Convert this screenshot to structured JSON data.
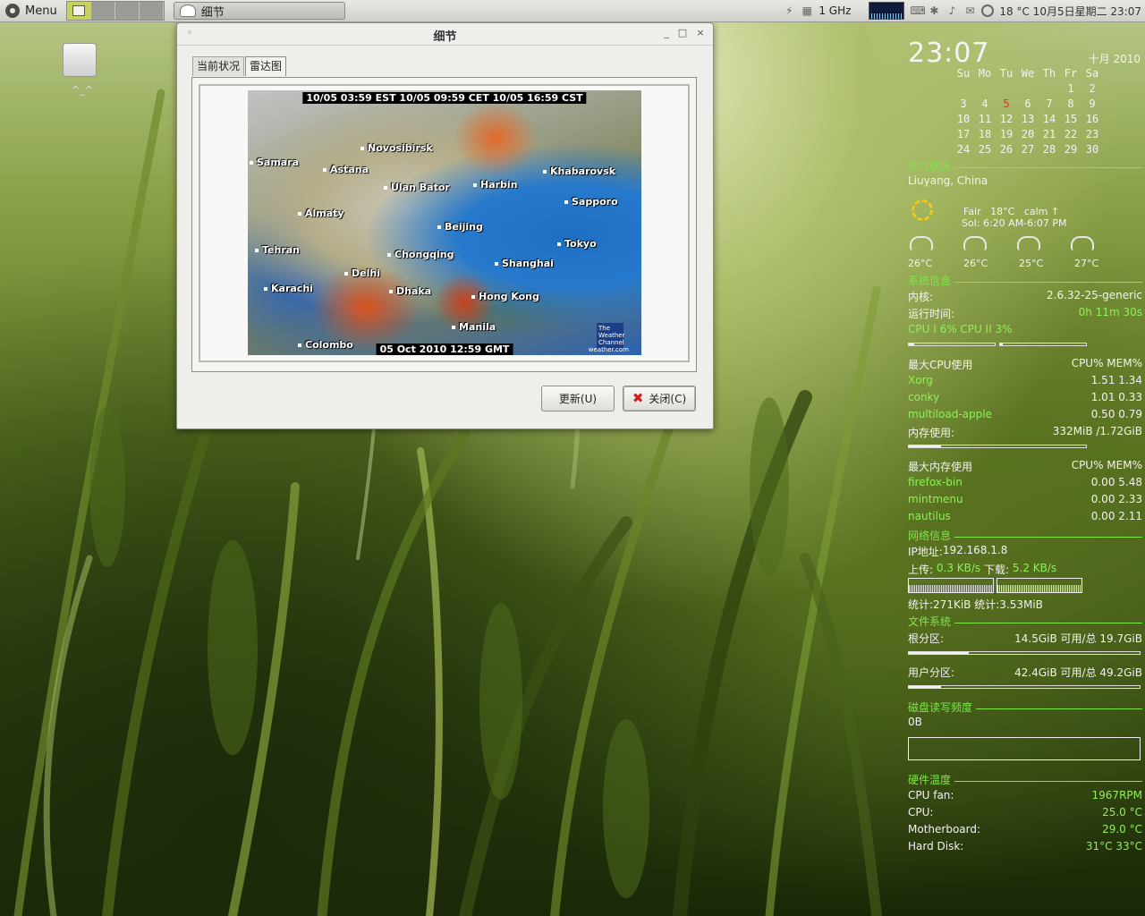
{
  "panel": {
    "menu_label": "Menu",
    "task_label": "细节",
    "cpu_freq": "1 GHz",
    "tray_text": "18 °C  10月5日星期二 23:07"
  },
  "desktop": {
    "drive_caption": "^_^"
  },
  "window": {
    "title": "细节",
    "tabs": [
      "当前状况",
      "雷达图"
    ],
    "active_tab": 1,
    "radar_top": "10/05 03:59 EST  10/05 09:59 CET  10/05 16:59 CST",
    "radar_bottom": "05 Oct 2010 12:59 GMT",
    "cities": [
      "Novosibirsk",
      "Samara",
      "Astana",
      "Khabarovsk",
      "Ulan Bator",
      "Harbin",
      "Sapporo",
      "Almaty",
      "Beijing",
      "Tokyo",
      "Tehran",
      "Chongqing",
      "Shanghai",
      "Delhi",
      "Karachi",
      "Dhaka",
      "Hong Kong",
      "Manila",
      "Colombo"
    ],
    "logo_text": "The Weather Channel",
    "logo_url": "weather.com",
    "refresh_label": "更新(U)",
    "close_label": "关闭(C)"
  },
  "conky": {
    "time": "23:07",
    "month_year": "十月 2010",
    "cal_header": [
      "Su",
      "Mo",
      "Tu",
      "We",
      "Th",
      "Fr",
      "Sa"
    ],
    "cal_rows": [
      [
        "",
        "",
        "",
        "",
        "",
        "1",
        "2"
      ],
      [
        "3",
        "4",
        "5",
        "6",
        "7",
        "8",
        "9"
      ],
      [
        "10",
        "11",
        "12",
        "13",
        "14",
        "15",
        "16"
      ],
      [
        "17",
        "18",
        "19",
        "20",
        "21",
        "22",
        "23"
      ],
      [
        "24",
        "25",
        "26",
        "27",
        "28",
        "29",
        "30"
      ]
    ],
    "today": "5",
    "weather_title": "天气状况",
    "location": "Liuyang, China",
    "cond": "Fair",
    "temp_now": "18°C",
    "wind": "calm",
    "sun": "Sol: 6:20 AM-6:07 PM",
    "forecast_temps": [
      "26°C",
      "26°C",
      "25°C",
      "27°C"
    ],
    "sys_title": "系统信息",
    "kernel_label": "内核:",
    "kernel": "2.6.32-25-generic",
    "uptime_label": "运行时间:",
    "uptime": "0h 11m 30s",
    "cpu_line": "CPU I 6% CPU II 3%",
    "cpu1_pct": 6,
    "cpu2_pct": 3,
    "topcpu_title": "最大CPU使用",
    "col_header": "CPU% MEM%",
    "topcpu": [
      {
        "name": "Xorg",
        "vals": "1.51  1.34"
      },
      {
        "name": "conky",
        "vals": "1.01  0.33"
      },
      {
        "name": "multiload-apple",
        "vals": "0.50  0.79"
      }
    ],
    "mem_label": "内存使用:",
    "mem_value": "332MiB /1.72GiB",
    "mem_pct": 18,
    "topmem_title": "最大内存使用",
    "topmem": [
      {
        "name": "firefox-bin",
        "vals": "0.00  5.48"
      },
      {
        "name": "mintmenu",
        "vals": "0.00  2.33"
      },
      {
        "name": "nautilus",
        "vals": "0.00  2.11"
      }
    ],
    "net_title": "网络信息",
    "ip_label": "IP地址:",
    "ip": "192.168.1.8",
    "up_label": "上传:",
    "up": "0.3 KB/s",
    "down_label": "下载:",
    "down": "5.2 KB/s",
    "totals": "统计:271KiB 统计:3.53MiB",
    "fs_title": "文件系统",
    "root_label": "根分区:",
    "root_value": "14.5GiB 可用/总 19.7GiB",
    "root_pct": 26,
    "home_label": "用户分区:",
    "home_value": "42.4GiB 可用/总 49.2GiB",
    "home_pct": 14,
    "disk_title": "磁盘读写频度",
    "disk_value": "0B",
    "hw_title": "硬件温度",
    "hw": [
      {
        "label": "CPU fan:",
        "value": "1967RPM"
      },
      {
        "label": "CPU:",
        "value": "25.0 °C"
      },
      {
        "label": "Motherboard:",
        "value": "29.0 °C"
      },
      {
        "label": "Hard Disk:",
        "value": "31°C  33°C"
      }
    ]
  }
}
